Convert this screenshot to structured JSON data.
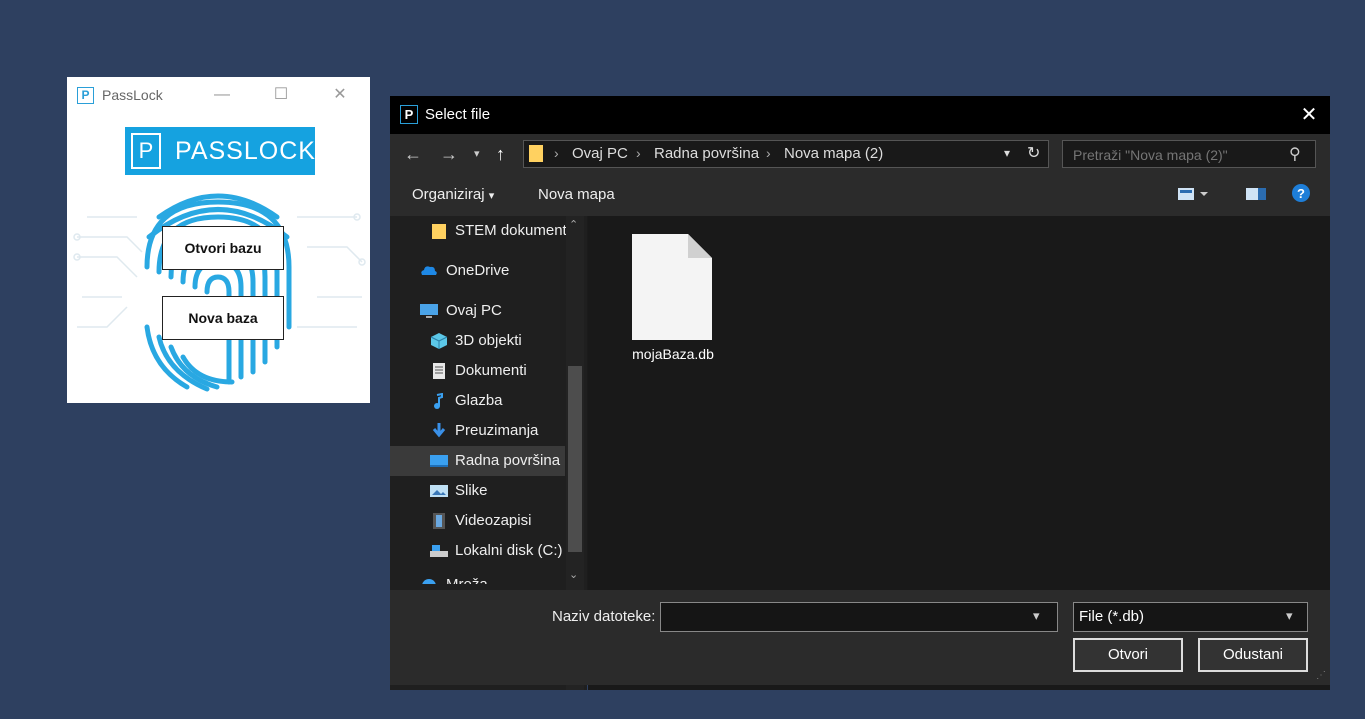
{
  "passlock": {
    "title": "PassLock",
    "app_icon_letter": "P",
    "logo_letter": "P",
    "logo_text": "PASSLOCK",
    "open_db_label": "Otvori bazu",
    "new_db_label": "Nova baza",
    "brand_color": "#15a2e0"
  },
  "dialog": {
    "title": "Select file",
    "icon_letter": "P",
    "breadcrumb": [
      "Ovaj PC",
      "Radna površina",
      "Nova mapa (2)"
    ],
    "search_placeholder": "Pretraži \"Nova mapa (2)\"",
    "toolbar": {
      "organize": "Organiziraj",
      "new_folder": "Nova mapa"
    },
    "sidebar": [
      {
        "label": "STEM dokument",
        "icon": "folder-icon"
      },
      {
        "label": "OneDrive",
        "icon": "cloud-icon"
      },
      {
        "label": "Ovaj PC",
        "icon": "computer-icon"
      },
      {
        "label": "3D objekti",
        "icon": "cube-icon"
      },
      {
        "label": "Dokumenti",
        "icon": "document-icon"
      },
      {
        "label": "Glazba",
        "icon": "music-icon"
      },
      {
        "label": "Preuzimanja",
        "icon": "download-icon"
      },
      {
        "label": "Radna površina",
        "icon": "desktop-icon",
        "selected": true
      },
      {
        "label": "Slike",
        "icon": "image-icon"
      },
      {
        "label": "Videozapisi",
        "icon": "video-icon"
      },
      {
        "label": "Lokalni disk (C:)",
        "icon": "disk-icon"
      },
      {
        "label": "Mreža",
        "icon": "network-icon"
      }
    ],
    "files": [
      {
        "name": "mojaBaza.db",
        "icon": "file-icon"
      }
    ],
    "filename_label": "Naziv datoteke:",
    "filename_value": "",
    "filter_value": "File (*.db)",
    "open_label": "Otvori",
    "cancel_label": "Odustani"
  }
}
